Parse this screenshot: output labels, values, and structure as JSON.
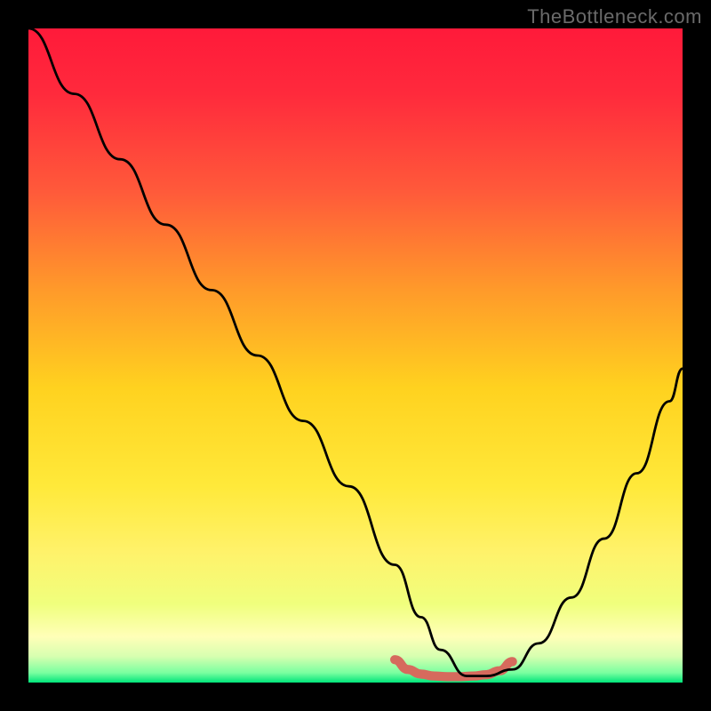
{
  "watermark": "TheBottleneck.com",
  "chart_data": {
    "type": "line",
    "title": "",
    "xlabel": "",
    "ylabel": "",
    "xlim": [
      0,
      100
    ],
    "ylim": [
      0,
      100
    ],
    "grid": false,
    "legend": false,
    "series": [
      {
        "name": "bottleneck-curve",
        "x": [
          0,
          7,
          14,
          21,
          28,
          35,
          42,
          49,
          56,
          60,
          63,
          67,
          70,
          74,
          78,
          83,
          88,
          93,
          98,
          100
        ],
        "values": [
          100,
          90,
          80,
          70,
          60,
          50,
          40,
          30,
          18,
          10,
          5,
          1,
          1,
          2,
          6,
          13,
          22,
          32,
          43,
          48
        ]
      },
      {
        "name": "sweet-spot-band",
        "x": [
          56,
          58,
          60,
          62,
          64,
          66,
          68,
          70,
          72,
          74
        ],
        "values": [
          3.5,
          2.0,
          1.3,
          1.0,
          0.9,
          0.9,
          1.0,
          1.2,
          1.8,
          3.2
        ]
      }
    ],
    "gradient_stops": [
      {
        "offset": 0.0,
        "color": "#ff1a3a"
      },
      {
        "offset": 0.1,
        "color": "#ff2a3c"
      },
      {
        "offset": 0.25,
        "color": "#ff5a3a"
      },
      {
        "offset": 0.4,
        "color": "#ff9a2a"
      },
      {
        "offset": 0.55,
        "color": "#ffd21f"
      },
      {
        "offset": 0.7,
        "color": "#ffe93a"
      },
      {
        "offset": 0.8,
        "color": "#fff26a"
      },
      {
        "offset": 0.88,
        "color": "#f0ff7d"
      },
      {
        "offset": 0.93,
        "color": "#ffffb8"
      },
      {
        "offset": 0.96,
        "color": "#d7ffb0"
      },
      {
        "offset": 0.985,
        "color": "#7affa0"
      },
      {
        "offset": 1.0,
        "color": "#00e47a"
      }
    ],
    "sweet_spot_color": "#d66a5d",
    "curve_color": "#000000"
  }
}
